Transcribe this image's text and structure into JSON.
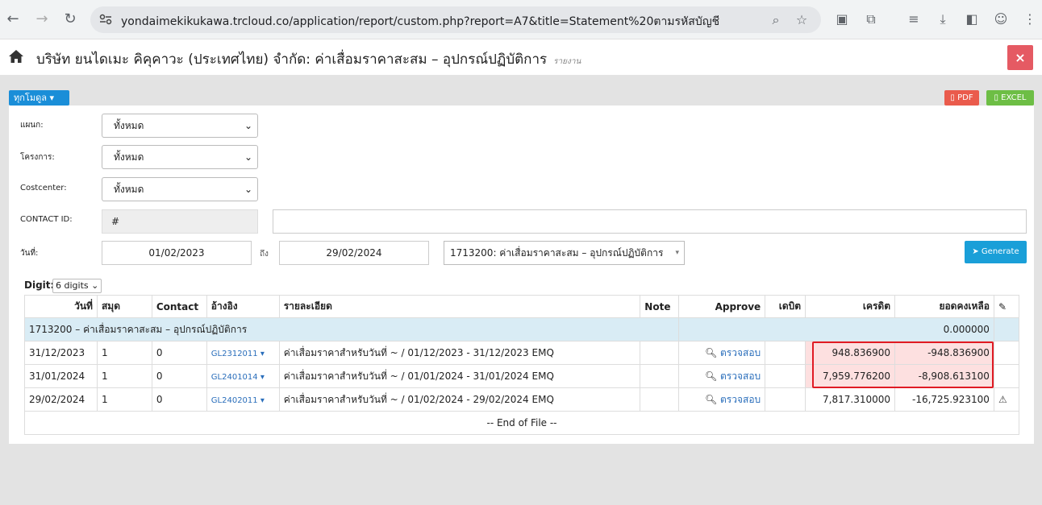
{
  "browser": {
    "url": "yondaimekikukawa.trcloud.co/application/report/custom.php?report=A7&title=Statement%20ตามรหัสบัญชี"
  },
  "header": {
    "title": "บริษัท ยนไดเมะ คิคุคาวะ (ประเทศไทย) จำกัด: ค่าเสื่อมราคาสะสม – อุปกรณ์ปฏิบัติการ",
    "subtitle": "รายงาน",
    "close_label": "×"
  },
  "toolbar": {
    "module_label": "ทุกโมดูล ▾",
    "pdf_label": "PDF",
    "excel_label": "EXCEL"
  },
  "filters": {
    "department_label": "แผนก:",
    "department_value": "ทั้งหมด",
    "project_label": "โครงการ:",
    "project_value": "ทั้งหมด",
    "costcenter_label": "Costcenter:",
    "costcenter_value": "ทั้งหมด",
    "contact_label": "CONTACT ID:",
    "contact_prefix": "#",
    "date_label": "วันที่:",
    "date_from": "01/02/2023",
    "to_label": "ถึง",
    "date_to": "29/02/2024",
    "account_value": "1713200: ค่าเสื่อมราคาสะสม – อุปกรณ์ปฏิบัติการ",
    "generate_label": "Generate"
  },
  "digit": {
    "label": "Digit:",
    "value": "6 digits"
  },
  "table": {
    "headers": {
      "date": "วันที่",
      "book": "สมุด",
      "contact": "Contact",
      "ref": "อ้างอิง",
      "detail": "รายละเอียด",
      "note": "Note",
      "approve": "Approve",
      "debit": "เดบิต",
      "credit": "เครดิต",
      "balance": "ยอดคงเหลือ"
    },
    "group": {
      "label": "1713200 – ค่าเสื่อมราคาสะสม – อุปกรณ์ปฏิบัติการ",
      "balance": "0.000000"
    },
    "rows": [
      {
        "date": "31/12/2023",
        "book": "1",
        "contact": "0",
        "ref": "GL2312011",
        "detail": "ค่าเสื่อมราคาสำหรับวันที่ ~ / 01/12/2023 - 31/12/2023 EMQ",
        "approve": "ตรวจสอบ",
        "credit": "948.836900",
        "balance": "-948.836900"
      },
      {
        "date": "31/01/2024",
        "book": "1",
        "contact": "0",
        "ref": "GL2401014",
        "detail": "ค่าเสื่อมราคาสำหรับวันที่ ~ / 01/01/2024 - 31/01/2024 EMQ",
        "approve": "ตรวจสอบ",
        "credit": "7,959.776200",
        "balance": "-8,908.613100"
      },
      {
        "date": "29/02/2024",
        "book": "1",
        "contact": "0",
        "ref": "GL2402011",
        "detail": "ค่าเสื่อมราคาสำหรับวันที่ ~ / 01/02/2024 - 29/02/2024 EMQ",
        "approve": "ตรวจสอบ",
        "credit": "7,817.310000",
        "balance": "-16,725.923100"
      }
    ],
    "footer": "-- End of File --"
  }
}
